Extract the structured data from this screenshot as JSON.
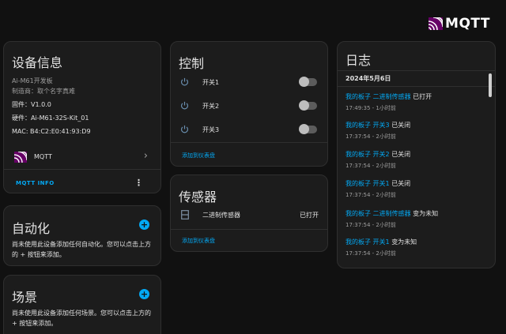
{
  "brand": {
    "logo_text": "MQTT"
  },
  "device_info": {
    "title": "设备信息",
    "model": "Ai-M61开发板",
    "manufacturer": "制造商：取个名字真难",
    "firmware": "固件：V1.0.0",
    "hardware": "硬件：Ai-M61-32S-Kit_01",
    "mac": "MAC: B4:C2:E0:41:93:D9",
    "integration_label": "MQTT",
    "mqtt_info_label": "MQTT INFO"
  },
  "automation": {
    "title": "自动化",
    "desc": "尚未使用此设备添加任何自动化。您可以点击上方的 + 按钮来添加。"
  },
  "scene": {
    "title": "场景",
    "desc": "尚未使用此设备添加任何场景。您可以点击上方的 + 按钮来添加。"
  },
  "controls": {
    "title": "控制",
    "items": [
      {
        "label": "开关1"
      },
      {
        "label": "开关2"
      },
      {
        "label": "开关3"
      }
    ],
    "add_to_dashboard": "添加到仪表盘"
  },
  "sensors": {
    "title": "传感器",
    "items": [
      {
        "label": "二进制传感器",
        "state": "已打开"
      }
    ],
    "add_to_dashboard": "添加到仪表盘"
  },
  "logbook": {
    "title": "日志",
    "date": "2024年5月6日",
    "entries": [
      {
        "entity": "我的板子 二进制传感器",
        "action": "已打开",
        "time": "17:49:35 - 1小时前"
      },
      {
        "entity": "我的板子 开关3",
        "action": "已关闭",
        "time": "17:37:54 - 2小时前"
      },
      {
        "entity": "我的板子 开关2",
        "action": "已关闭",
        "time": "17:37:54 - 2小时前"
      },
      {
        "entity": "我的板子 开关1",
        "action": "已关闭",
        "time": "17:37:54 - 2小时前"
      },
      {
        "entity": "我的板子 二进制传感器",
        "action": "变为未知",
        "time": "17:37:54 - 2小时前"
      },
      {
        "entity": "我的板子 开关1",
        "action": "变为未知",
        "time": "17:37:54 - 2小时前"
      }
    ]
  },
  "colors": {
    "background": "#111111",
    "card": "#1c1c1c",
    "accent": "#03a9f4",
    "mqtt_purple": "#660066"
  }
}
